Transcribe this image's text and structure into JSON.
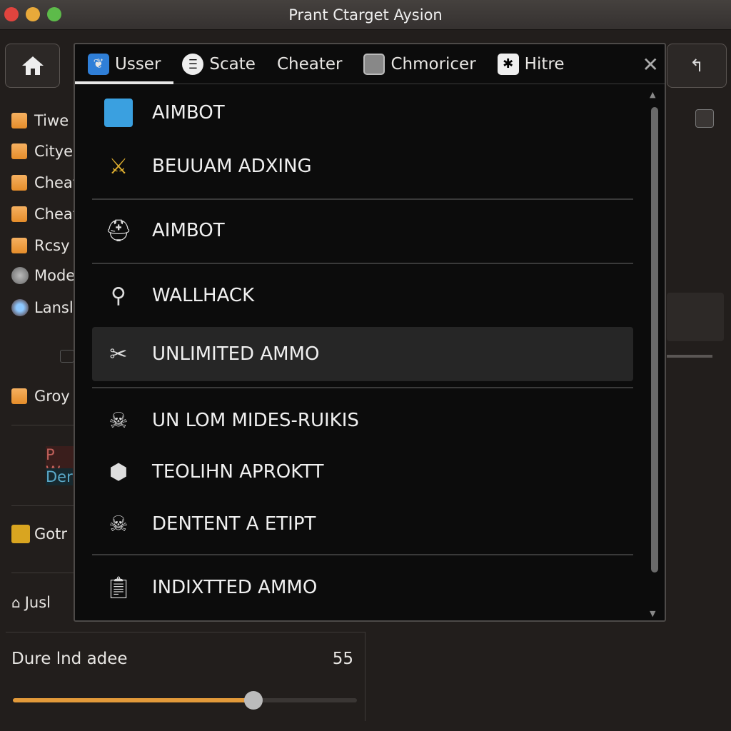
{
  "window": {
    "title": "Prant Ctarget Aysion",
    "controls": {
      "close": "#e0443e",
      "minimize": "#e8a93a",
      "maximize": "#5dbb4a"
    }
  },
  "toolbar": {
    "home_icon": "home-icon",
    "back_icon": "undo-arrow-icon"
  },
  "sidebar": {
    "items": [
      {
        "label": "Tiwe",
        "type": "checkbox"
      },
      {
        "label": "Cityel",
        "type": "checkbox"
      },
      {
        "label": "Cheat",
        "type": "checkbox"
      },
      {
        "label": "Cheat",
        "type": "checkbox"
      },
      {
        "label": "Rcsy",
        "type": "checkbox"
      },
      {
        "label": "Model",
        "type": "radio"
      },
      {
        "label": "Lansl",
        "type": "radio",
        "selected": true
      }
    ],
    "group_label": "Groy",
    "warn_text": "P W",
    "info_text": "Der",
    "gotr_label": "Gotr",
    "user_label": "Jusl"
  },
  "tabs": [
    {
      "label": "Usser",
      "icon": "feather-icon",
      "active": true
    },
    {
      "label": "Scate",
      "icon": "toggle-icon"
    },
    {
      "label": "Cheater"
    },
    {
      "label": "Chmoricer",
      "icon": "badge-icon"
    },
    {
      "label": "Hitre",
      "icon": "gear-icon"
    }
  ],
  "menu": {
    "items": [
      {
        "label": "AIMBOT",
        "icon": "app-icon"
      },
      {
        "label": "BEUUAM ADXING",
        "icon": "sword-icon"
      },
      {
        "label": "AIMBOT",
        "icon": "helmet-icon"
      },
      {
        "label": "WALLHACK",
        "icon": "wrench-icon"
      },
      {
        "label": "UNLIMITED AMMO",
        "icon": "scissors-icon",
        "highlighted": true
      },
      {
        "label": "UN LOM MIDES-RUIKIS",
        "icon": "skull-icon"
      },
      {
        "label": "TEOLIHN APROKTT",
        "icon": "cube-icon"
      },
      {
        "label": "DENTENT A ETIPT",
        "icon": "skull-icon"
      },
      {
        "label": "INDIXTTED AMMO",
        "icon": "clipboard-icon"
      }
    ]
  },
  "bottom": {
    "label": "Dure lnd adee",
    "value": "55",
    "slider_fill_percent": 70
  },
  "accent": "#e39a3a"
}
